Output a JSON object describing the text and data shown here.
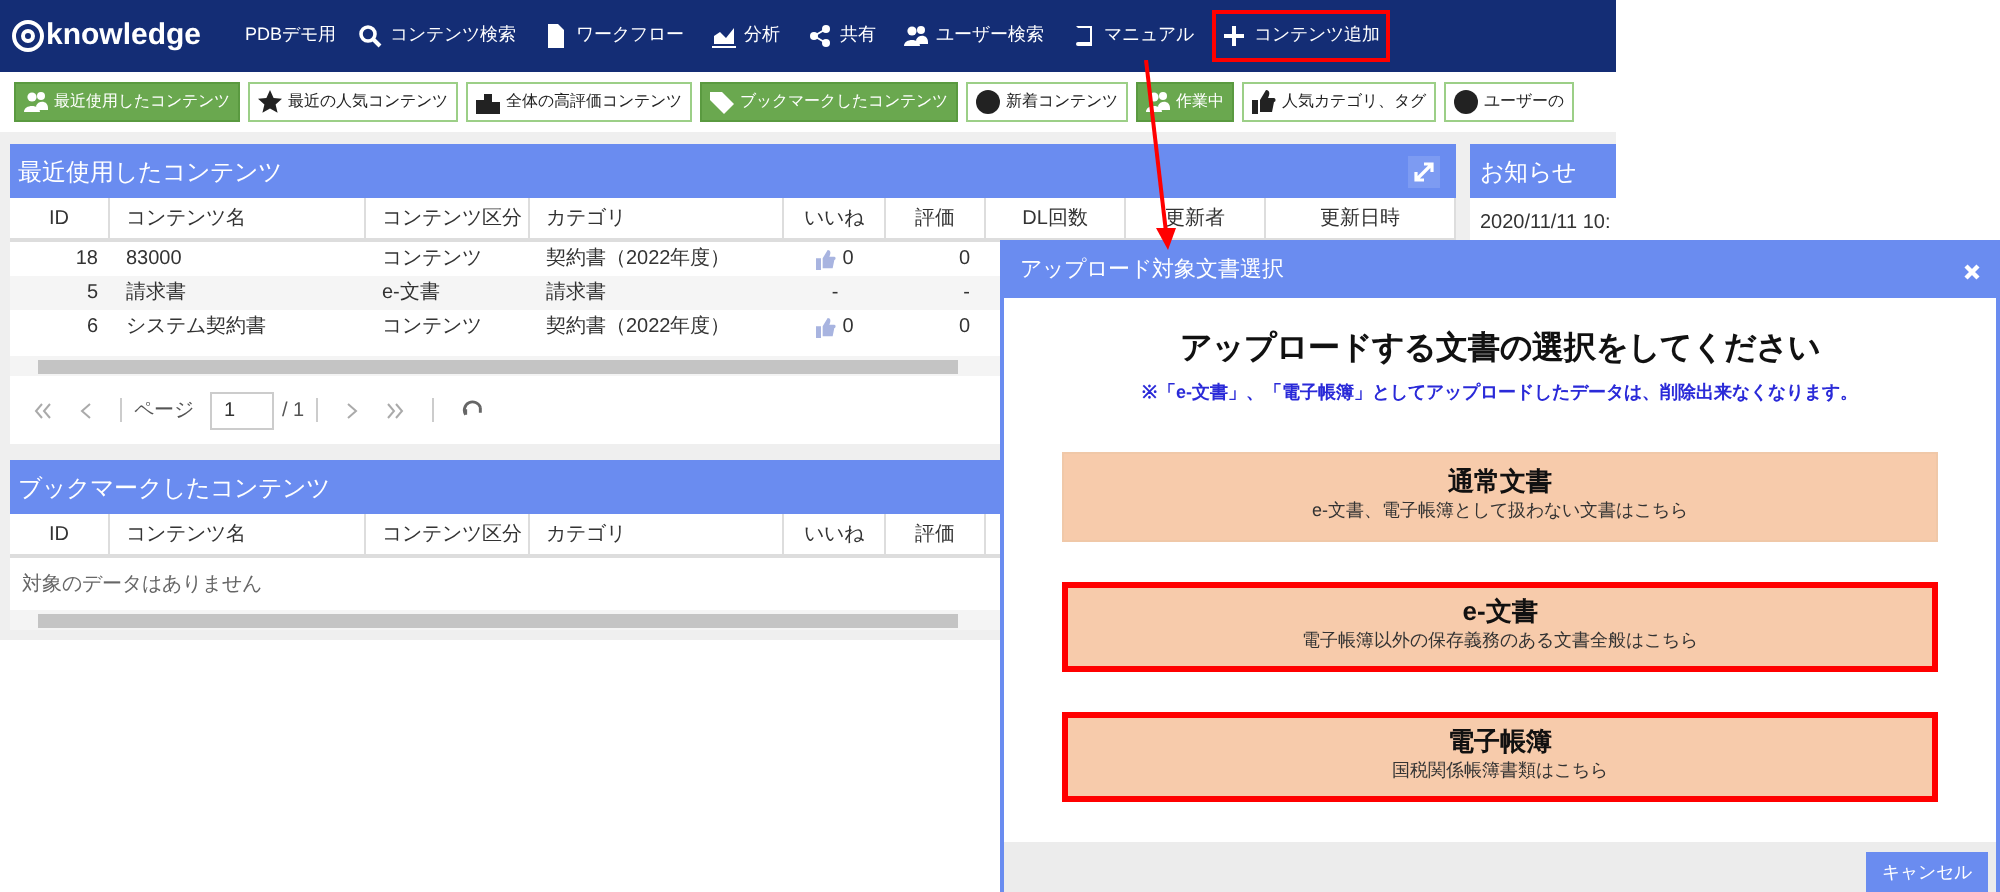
{
  "nav": {
    "logo": "knowledge",
    "site": "PDBデモ用",
    "items": [
      {
        "label": "コンテンツ検索",
        "highlighted": false
      },
      {
        "label": "ワークフロー",
        "highlighted": false
      },
      {
        "label": "分析",
        "highlighted": false
      },
      {
        "label": "共有",
        "highlighted": false
      },
      {
        "label": "ユーザー検索",
        "highlighted": false
      },
      {
        "label": "マニュアル",
        "highlighted": false
      },
      {
        "label": "コンテンツ追加",
        "highlighted": true
      }
    ]
  },
  "toolbar": [
    {
      "label": "最近使用したコンテンツ",
      "selected": true
    },
    {
      "label": "最近の人気コンテンツ",
      "selected": false
    },
    {
      "label": "全体の高評価コンテンツ",
      "selected": false
    },
    {
      "label": "ブックマークしたコンテンツ",
      "selected": true
    },
    {
      "label": "新着コンテンツ",
      "selected": false
    },
    {
      "label": "作業中",
      "selected": true
    },
    {
      "label": "人気カテゴリ、タグ",
      "selected": false
    },
    {
      "label": "ユーザーの",
      "selected": false
    }
  ],
  "recent": {
    "title": "最近使用したコンテンツ",
    "columns": [
      "ID",
      "コンテンツ名",
      "コンテンツ区分",
      "カテゴリ",
      "いいね",
      "評価",
      "DL回数",
      "更新者",
      "更新日時"
    ],
    "rows": [
      {
        "id": "18",
        "name": "83000",
        "type": "コンテンツ",
        "category": "契約書（2022年度）",
        "likes": "0",
        "liked_icon": true,
        "rating": "0"
      },
      {
        "id": "5",
        "name": "請求書",
        "type": "e-文書",
        "category": "請求書",
        "likes": "-",
        "liked_icon": false,
        "rating": "-"
      },
      {
        "id": "6",
        "name": "システム契約書",
        "type": "コンテンツ",
        "category": "契約書（2022年度）",
        "likes": "0",
        "liked_icon": true,
        "rating": "0"
      }
    ],
    "pager": {
      "label": "ページ",
      "page": "1",
      "total": "/ 1"
    }
  },
  "bookmarks": {
    "title": "ブックマークしたコンテンツ",
    "columns": [
      "ID",
      "コンテンツ名",
      "コンテンツ区分",
      "カテゴリ",
      "いいね",
      "評価"
    ],
    "empty": "対象のデータはありません"
  },
  "notices": {
    "title": "お知らせ",
    "items": [
      "2020/11/11 10:"
    ]
  },
  "dialog": {
    "title": "アップロード対象文書選択",
    "heading": "アップロードする文書の選択をしてください",
    "note": "※「e-文書」、「電子帳簿」としてアップロードしたデータは、削除出来なくなります。",
    "options": [
      {
        "title": "通常文書",
        "description": "e-文書、電子帳簿として扱わない文書はこちら",
        "highlighted": false
      },
      {
        "title": "e-文書",
        "description": "電子帳簿以外の保存義務のある文書全般はこちら",
        "highlighted": true
      },
      {
        "title": "電子帳簿",
        "description": "国税関係帳簿書類はこちら",
        "highlighted": true
      }
    ],
    "cancel": "キャンセル"
  }
}
